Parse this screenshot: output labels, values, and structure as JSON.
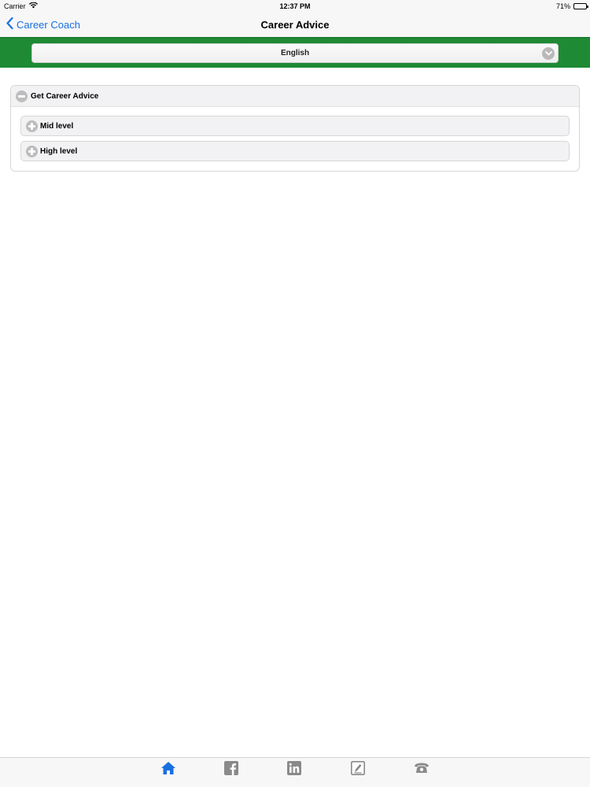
{
  "status": {
    "carrier": "Carrier",
    "time": "12:37 PM",
    "battery": "71%",
    "battery_level": 0.71
  },
  "nav": {
    "back_label": "Career Coach",
    "title": "Career Advice"
  },
  "language_select": {
    "value": "English"
  },
  "accordion": {
    "header": "Get Career Advice",
    "items": [
      {
        "label": "Mid level"
      },
      {
        "label": "High level"
      }
    ]
  },
  "colors": {
    "accent": "#1a6fe0",
    "green_bar": "#1e8a34",
    "tab_active": "#1a6fe0",
    "tab_inactive": "#8a8a8a"
  },
  "tabs": [
    {
      "icon": "home-icon",
      "active": true
    },
    {
      "icon": "facebook-icon",
      "active": false
    },
    {
      "icon": "linkedin-icon",
      "active": false
    },
    {
      "icon": "edit-icon",
      "active": false
    },
    {
      "icon": "phone-icon",
      "active": false
    }
  ]
}
